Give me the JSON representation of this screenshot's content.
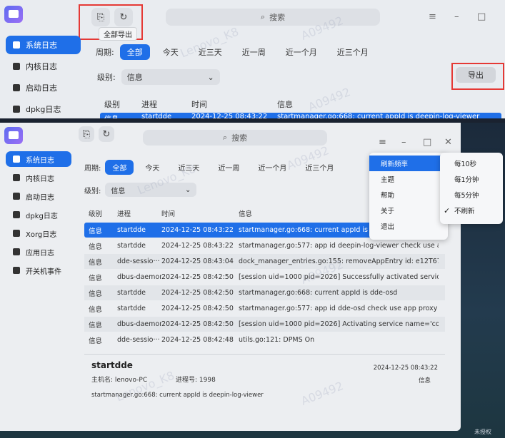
{
  "top": {
    "search_placeholder": "搜索",
    "tooltip": "全部导出",
    "sidebar": [
      {
        "label": "系统日志",
        "active": true
      },
      {
        "label": "内核日志",
        "active": false
      },
      {
        "label": "启动日志",
        "active": false
      },
      {
        "label": "dpkg日志",
        "active": false
      }
    ],
    "period_label": "周期:",
    "periods": [
      "全部",
      "今天",
      "近三天",
      "近一周",
      "近一个月",
      "近三个月"
    ],
    "level_label": "级别:",
    "level_value": "信息",
    "export_label": "导出",
    "headers": [
      "级别",
      "进程",
      "时间",
      "信息"
    ],
    "partial_row": {
      "level": "信息",
      "process": "startdde",
      "time": "2024-12-25 08:43:22",
      "info": "startmanager.go:668: current appId is deepin-log-viewer"
    }
  },
  "bottom": {
    "search_placeholder": "搜索",
    "sidebar": [
      {
        "label": "系统日志",
        "active": true
      },
      {
        "label": "内核日志",
        "active": false
      },
      {
        "label": "启动日志",
        "active": false
      },
      {
        "label": "dpkg日志",
        "active": false
      },
      {
        "label": "Xorg日志",
        "active": false
      },
      {
        "label": "应用日志",
        "active": false
      },
      {
        "label": "开关机事件",
        "active": false
      }
    ],
    "period_label": "周期:",
    "periods": [
      "全部",
      "今天",
      "近三天",
      "近一周",
      "近一个月",
      "近三个月"
    ],
    "level_label": "级别:",
    "level_value": "信息",
    "headers": [
      "级别",
      "进程",
      "时间",
      "信息"
    ],
    "rows": [
      {
        "level": "信息",
        "process": "startdde",
        "time": "2024-12-25 08:43:22",
        "info": "startmanager.go:668: current appId is deepin-log-viewer"
      },
      {
        "level": "信息",
        "process": "startdde",
        "time": "2024-12-25 08:43:22",
        "info": "startmanager.go:577: app id deepin-log-viewer check use app proxy"
      },
      {
        "level": "信息",
        "process": "dde-sessio···",
        "time": "2024-12-25 08:43:04",
        "info": "dock_manager_entries.go:155: removeAppEntry id: e12T67692f0b"
      },
      {
        "level": "信息",
        "process": "dbus-daemon",
        "time": "2024-12-25 08:42:50",
        "info": "[session uid=1000 pid=2026] Successfully activated service 'com.deepi···"
      },
      {
        "level": "信息",
        "process": "startdde",
        "time": "2024-12-25 08:42:50",
        "info": "startmanager.go:668: current appId is dde-osd"
      },
      {
        "level": "信息",
        "process": "startdde",
        "time": "2024-12-25 08:42:50",
        "info": "startmanager.go:577: app id dde-osd check use app proxy"
      },
      {
        "level": "信息",
        "process": "dbus-daemon",
        "time": "2024-12-25 08:42:50",
        "info": "[session uid=1000 pid=2026] Activating service name='com.deepin.dd···"
      },
      {
        "level": "信息",
        "process": "dde-sessio···",
        "time": "2024-12-25 08:42:48",
        "info": "utils.go:121: DPMS On"
      }
    ],
    "detail": {
      "title": "startdde",
      "host_label": "主机名:",
      "host_value": "lenovo-PC",
      "pid_label": "进程号:",
      "pid_value": "1998",
      "time": "2024-12-25 08:43:22",
      "level": "信息",
      "message": "startmanager.go:668: current appId is deepin-log-viewer"
    },
    "menu": {
      "items": [
        "刷新频率",
        "主题",
        "帮助",
        "关于",
        "退出"
      ],
      "submenu": [
        "每10秒",
        "每1分钟",
        "每5分钟",
        "不刷新"
      ],
      "checked": "不刷新"
    },
    "corner_text": "未授权"
  }
}
